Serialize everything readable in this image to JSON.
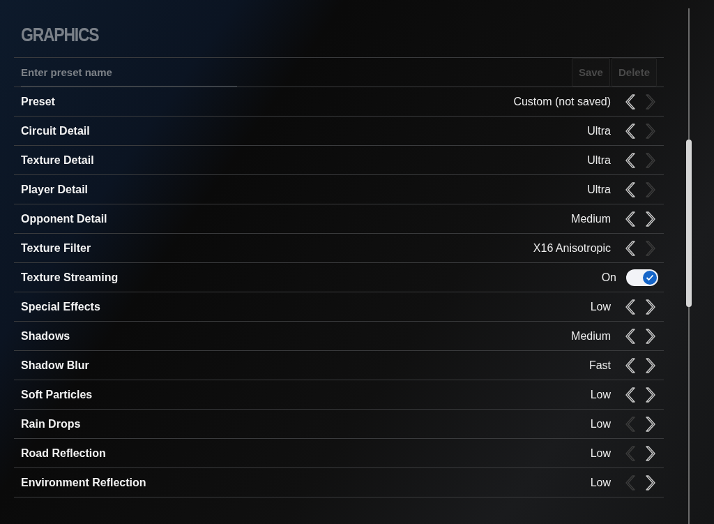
{
  "title": "GRAPHICS",
  "preset_bar": {
    "placeholder": "Enter preset name",
    "buttons": [
      {
        "label": "Save",
        "disabled": true
      },
      {
        "label": "Delete",
        "disabled": true
      }
    ]
  },
  "settings": [
    {
      "kind": "select",
      "label": "Preset",
      "value": "Custom (not saved)",
      "prev_disabled": false,
      "next_disabled": true
    },
    {
      "kind": "select",
      "label": "Circuit Detail",
      "value": "Ultra",
      "prev_disabled": false,
      "next_disabled": true
    },
    {
      "kind": "select",
      "label": "Texture Detail",
      "value": "Ultra",
      "prev_disabled": false,
      "next_disabled": true
    },
    {
      "kind": "select",
      "label": "Player Detail",
      "value": "Ultra",
      "prev_disabled": false,
      "next_disabled": true
    },
    {
      "kind": "select",
      "label": "Opponent Detail",
      "value": "Medium",
      "prev_disabled": false,
      "next_disabled": false
    },
    {
      "kind": "select",
      "label": "Texture Filter",
      "value": "X16 Anisotropic",
      "prev_disabled": false,
      "next_disabled": true
    },
    {
      "kind": "toggle",
      "label": "Texture Streaming",
      "value": "On",
      "on": true
    },
    {
      "kind": "select",
      "label": "Special Effects",
      "value": "Low",
      "prev_disabled": false,
      "next_disabled": false
    },
    {
      "kind": "select",
      "label": "Shadows",
      "value": "Medium",
      "prev_disabled": false,
      "next_disabled": false
    },
    {
      "kind": "select",
      "label": "Shadow Blur",
      "value": "Fast",
      "prev_disabled": false,
      "next_disabled": false
    },
    {
      "kind": "select",
      "label": "Soft Particles",
      "value": "Low",
      "prev_disabled": false,
      "next_disabled": false
    },
    {
      "kind": "select",
      "label": "Rain Drops",
      "value": "Low",
      "prev_disabled": true,
      "next_disabled": false
    },
    {
      "kind": "select",
      "label": "Road Reflection",
      "value": "Low",
      "prev_disabled": true,
      "next_disabled": false
    },
    {
      "kind": "select",
      "label": "Environment Reflection",
      "value": "Low",
      "prev_disabled": true,
      "next_disabled": false
    }
  ]
}
